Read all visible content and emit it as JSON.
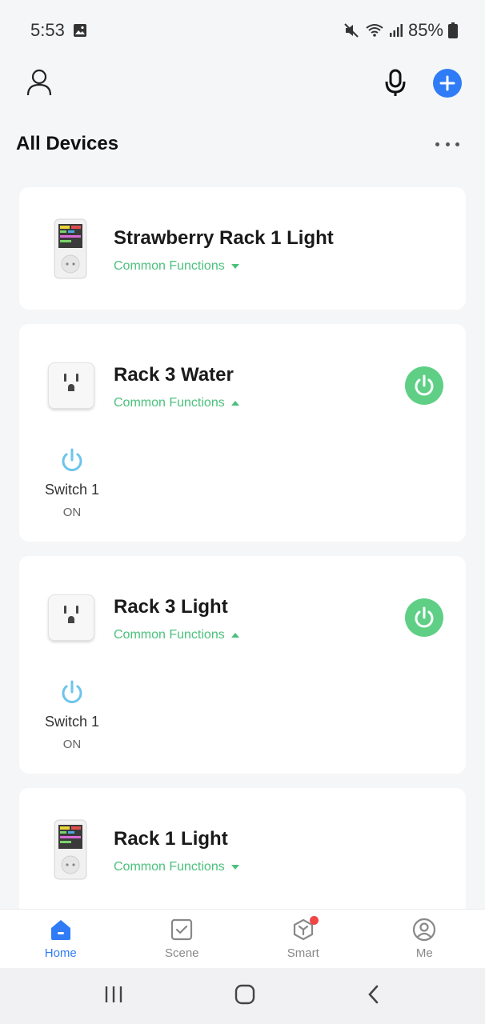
{
  "status": {
    "time": "5:53",
    "battery": "85%"
  },
  "section": {
    "title": "All Devices"
  },
  "devices": [
    {
      "name": "Strawberry Rack 1 Light",
      "functions_label": "Common Functions"
    },
    {
      "name": "Rack 3 Water",
      "functions_label": "Common Functions",
      "switch_label": "Switch 1",
      "switch_state": "ON"
    },
    {
      "name": "Rack 3 Light",
      "functions_label": "Common Functions",
      "switch_label": "Switch 1",
      "switch_state": "ON"
    },
    {
      "name": "Rack 1 Light",
      "functions_label": "Common Functions"
    }
  ],
  "tabs": [
    {
      "label": "Home",
      "icon": "home-icon",
      "active": true
    },
    {
      "label": "Scene",
      "icon": "scene-icon"
    },
    {
      "label": "Smart",
      "icon": "smart-icon"
    },
    {
      "label": "Me",
      "icon": "me-icon"
    }
  ],
  "colors": {
    "accent": "#2f7cf6",
    "green": "#4cc17d",
    "power": "#5fcf85",
    "switch": "#6cc4ea",
    "badge": "#f04646"
  }
}
